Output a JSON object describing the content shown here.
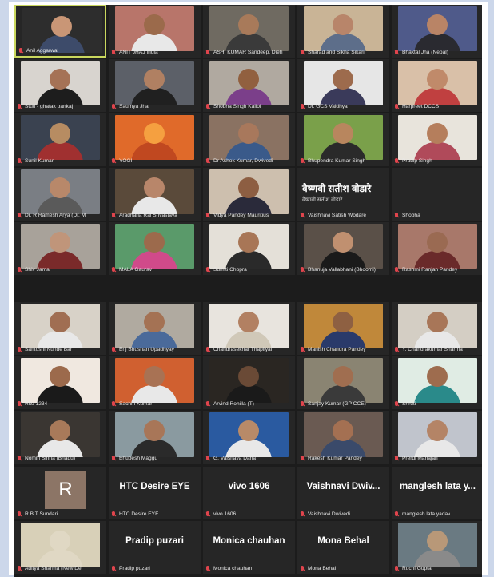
{
  "colors": {
    "outer_bg": "#ccd7ea",
    "grid_bg": "#1c1c1c",
    "tile_bg": "#262626",
    "active_speaker_border": "#c9d75e",
    "muted_mic": "#e0454d",
    "avatar_bg": "#8c7566"
  },
  "muted_icon": "mic-muted-icon",
  "rows": [
    {
      "tiles": [
        {
          "name": "Anil Aggarwal",
          "type": "video",
          "active": true,
          "bg": "#2d2d2d",
          "skin": "#c99676",
          "cloth": "#3d4b6a"
        },
        {
          "name": "ANIT JHAJ India",
          "type": "video",
          "bg": "#b8756a",
          "skin": "#9b6a4b",
          "cloth": "#e8e8e8"
        },
        {
          "name": "ASHI KUMAR Sandeep, Dieh",
          "type": "video",
          "bg": "#6f6a61",
          "skin": "#a87a5a",
          "cloth": "#3a3a3a"
        },
        {
          "name": "Sharad and Sikha Sikari",
          "type": "video",
          "bg": "#c9b496",
          "skin": "#b8856a",
          "cloth": "#5d6e8a"
        },
        {
          "name": "Bhaktal Jha (Nepal)",
          "type": "video",
          "bg": "#4f5a8a",
          "skin": "#b98466",
          "cloth": "#2a2a30"
        }
      ]
    },
    {
      "tiles": [
        {
          "name": "Stuti - ghatak pankaj",
          "type": "video",
          "bg": "#d8d4cf",
          "skin": "#a57256",
          "cloth": "#1d1d1d"
        },
        {
          "name": "Saumya Jha",
          "type": "video",
          "bg": "#5c6068",
          "skin": "#b08062",
          "cloth": "#202020"
        },
        {
          "name": "Shobha Singh Kallol",
          "type": "video",
          "bg": "#b0a9a0",
          "skin": "#91603f",
          "cloth": "#7b3f8a"
        },
        {
          "name": "Dr. GCS Vaidhya",
          "type": "video",
          "bg": "#e6e6e6",
          "skin": "#9d6b4d",
          "cloth": "#3a3a5a"
        },
        {
          "name": "Harpreet DCCS",
          "type": "video",
          "bg": "#d9c0a8",
          "skin": "#c08a6a",
          "cloth": "#c04040"
        }
      ]
    },
    {
      "tiles": [
        {
          "name": "Sunil Kumar",
          "type": "video",
          "bg": "#3a4250",
          "skin": "#b78c62",
          "cloth": "#a03030"
        },
        {
          "name": "YOGI",
          "type": "video",
          "bg": "#e06a2a",
          "skin": "#f5a040",
          "cloth": "#c04820"
        },
        {
          "name": "Dr Ashok Kumar, Dwivedi",
          "type": "video",
          "bg": "#8a7262",
          "skin": "#a8785c",
          "cloth": "#3a5a8a"
        },
        {
          "name": "Bhupendra Kumar Singh",
          "type": "video",
          "bg": "#7aa04a",
          "skin": "#b8865e",
          "cloth": "#2a2a2a"
        },
        {
          "name": "Pradip Singh",
          "type": "video",
          "bg": "#e8e4dc",
          "skin": "#b57e5c",
          "cloth": "#b04a5a"
        }
      ]
    },
    {
      "tiles": [
        {
          "name": "Dr. R Ramesh Arya (Dr. M",
          "type": "video",
          "bg": "#7a7e84",
          "skin": "#b8886a",
          "cloth": "#5a5a5a"
        },
        {
          "name": "Aradhana Rai Srivastava",
          "type": "video",
          "bg": "#5a4a3a",
          "skin": "#b8866a",
          "cloth": "#e8e8e8"
        },
        {
          "name": "Vidya Pandey Mauritius",
          "type": "video",
          "bg": "#cdbfae",
          "skin": "#8d5e42",
          "cloth": "#2a2a3a"
        },
        {
          "name": "Vaishnavi Satish Wodare",
          "type": "hindi",
          "headline": "वैष्णवी सतीश वोडारे",
          "sub": "वैष्णवी सतीश वोडारे"
        },
        {
          "name": "Shobha",
          "type": "blank"
        }
      ]
    },
    {
      "tiles": [
        {
          "name": "Shiv Jamal",
          "type": "video",
          "bg": "#a8a29a",
          "skin": "#c0957a",
          "cloth": "#7a2a2a"
        },
        {
          "name": "MALA Gaurav",
          "type": "video",
          "bg": "#5a9a6a",
          "skin": "#9c6a4c",
          "cloth": "#d04a8a"
        },
        {
          "name": "Sumiti Chopra",
          "type": "video",
          "bg": "#e4e0d8",
          "skin": "#a87656",
          "cloth": "#2a2a2a"
        },
        {
          "name": "Bhanuja Vallabhani (Bhoomi)",
          "type": "video",
          "bg": "#5a5048",
          "skin": "#c09070",
          "cloth": "#1a1a1a"
        },
        {
          "name": "Rashmi Ranjan Pandey",
          "type": "video",
          "bg": "#a8786a",
          "skin": "#9a6a52",
          "cloth": "#6a2a2a"
        }
      ]
    },
    {
      "tiles": [
        {
          "name": "Santoshi Nunde Bar",
          "type": "video",
          "bg": "#d8d2c8",
          "skin": "#a06e52",
          "cloth": "#e8e8e8"
        },
        {
          "name": "Brij Bhushan Upadhyay",
          "type": "video",
          "bg": "#b0aaa0",
          "skin": "#a47254",
          "cloth": "#4a6a9a"
        },
        {
          "name": "Chandrasekhar Thapliyal",
          "type": "video",
          "bg": "#e8e4de",
          "skin": "#b28062",
          "cloth": "#d0c8b8"
        },
        {
          "name": "Manish Chandra Pandey",
          "type": "video",
          "bg": "#c0883a",
          "skin": "#8e6042",
          "cloth": "#2a3a6a"
        },
        {
          "name": "Y. Chandrakumar Sharma",
          "type": "video",
          "bg": "#d4cec4",
          "skin": "#a87658",
          "cloth": "#e8e8e8"
        }
      ]
    },
    {
      "tiles": [
        {
          "name": "Ritu 1234",
          "type": "video",
          "bg": "#f0e8e0",
          "skin": "#9c6a4c",
          "cloth": "#1a1a1a"
        },
        {
          "name": "Sachin Kumar",
          "type": "video",
          "bg": "#d06030",
          "skin": "#a87254",
          "cloth": "#e8e8e8"
        },
        {
          "name": "Arvind Rohilla (T)",
          "type": "video",
          "bg": "#2a2622",
          "skin": "#6a4a36",
          "cloth": "#1a1a1a"
        },
        {
          "name": "Sanjay Kumar (GP CCE)",
          "type": "video",
          "bg": "#8a8472",
          "skin": "#a06e50",
          "cloth": "#3a3a3a"
        },
        {
          "name": "Shruti",
          "type": "video",
          "bg": "#e0ece4",
          "skin": "#9e6c4e",
          "cloth": "#2a8a8a"
        }
      ]
    },
    {
      "tiles": [
        {
          "name": "Nomin Sinha (Bhadu)",
          "type": "video",
          "bg": "#3a3632",
          "skin": "#a87a5a",
          "cloth": "#e8e8e8"
        },
        {
          "name": "Bhupesh Maggu",
          "type": "video",
          "bg": "#8a9aa0",
          "skin": "#a87658",
          "cloth": "#2a2a2a"
        },
        {
          "name": "G. Vaisnava Daha",
          "type": "video",
          "bg": "#2a5aa0",
          "skin": "#b88a68",
          "cloth": "#e8e8e8"
        },
        {
          "name": "Rakesh Kumar Pandey",
          "type": "video",
          "bg": "#6a5a52",
          "skin": "#a47052",
          "cloth": "#3a4a6a"
        },
        {
          "name": "Prerdi Mahajan",
          "type": "video",
          "bg": "#c0c4cc",
          "skin": "#b48466",
          "cloth": "#e8e8e8"
        }
      ]
    },
    {
      "tiles": [
        {
          "name": "R B T Sundari",
          "type": "avatar",
          "letter": "R"
        },
        {
          "name": "HTC Desire EYE",
          "type": "text",
          "headline": "HTC Desire EYE"
        },
        {
          "name": "vivo 1606",
          "type": "text",
          "headline": "vivo 1606"
        },
        {
          "name": "Vaishnavi Dwivedi",
          "type": "text",
          "headline": "Vaishnavi  Dwiv..."
        },
        {
          "name": "manglesh lata yadav",
          "type": "text",
          "headline": "manglesh  lata  y..."
        }
      ]
    },
    {
      "tiles": [
        {
          "name": "Aditya Sharma (New Del",
          "type": "video",
          "bg": "#d8d0b8",
          "skin": "#e0d8c4",
          "cloth": "#e0d8c4"
        },
        {
          "name": "Pradip puzari",
          "type": "text",
          "headline": "Pradip puzari"
        },
        {
          "name": "Monica chauhan",
          "type": "text",
          "headline": "Monica chauhan"
        },
        {
          "name": "Mona Behal",
          "type": "text",
          "headline": "Mona Behal"
        },
        {
          "name": "Ruchi Gupta",
          "type": "video",
          "bg": "#6a7a82",
          "skin": "#b89878",
          "cloth": "#8a8a8a"
        }
      ]
    }
  ]
}
